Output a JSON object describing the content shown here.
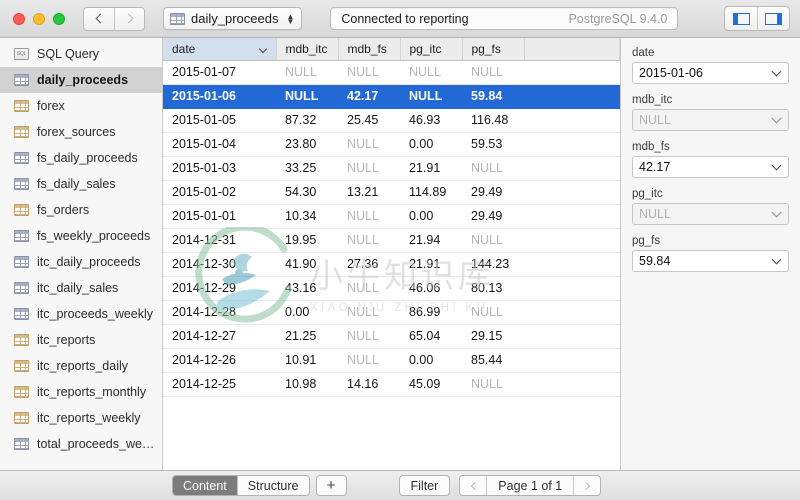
{
  "titlebar": {
    "back_label": "Back",
    "forward_label": "Forward",
    "table_picker_label": "daily_proceeds",
    "table_picker_icon": "table-icon",
    "status_text": "Connected to reporting",
    "server_version": "PostgreSQL 9.4.0",
    "left_panel_toggle": "left-panel-icon",
    "right_panel_toggle": "right-panel-icon"
  },
  "sidebar": {
    "items": [
      {
        "label": "SQL Query",
        "icon": "sql-query-icon",
        "selected": false
      },
      {
        "label": "daily_proceeds",
        "icon": "table-icon",
        "selected": true
      },
      {
        "label": "forex",
        "icon": "table-icon",
        "selected": false
      },
      {
        "label": "forex_sources",
        "icon": "table-icon",
        "selected": false
      },
      {
        "label": "fs_daily_proceeds",
        "icon": "table-icon",
        "selected": false
      },
      {
        "label": "fs_daily_sales",
        "icon": "table-icon",
        "selected": false
      },
      {
        "label": "fs_orders",
        "icon": "table-icon",
        "selected": false
      },
      {
        "label": "fs_weekly_proceeds",
        "icon": "table-icon",
        "selected": false
      },
      {
        "label": "itc_daily_proceeds",
        "icon": "table-icon",
        "selected": false
      },
      {
        "label": "itc_daily_sales",
        "icon": "table-icon",
        "selected": false
      },
      {
        "label": "itc_proceeds_weekly",
        "icon": "table-icon",
        "selected": false
      },
      {
        "label": "itc_reports",
        "icon": "table-icon",
        "selected": false
      },
      {
        "label": "itc_reports_daily",
        "icon": "table-icon",
        "selected": false
      },
      {
        "label": "itc_reports_monthly",
        "icon": "table-icon",
        "selected": false
      },
      {
        "label": "itc_reports_weekly",
        "icon": "table-icon",
        "selected": false
      },
      {
        "label": "total_proceeds_we…",
        "icon": "table-icon",
        "selected": false
      }
    ]
  },
  "grid": {
    "columns": [
      "date",
      "mdb_itc",
      "mdb_fs",
      "pg_itc",
      "pg_fs"
    ],
    "sorted_column": "date",
    "sort_direction": "descending",
    "null_text": "NULL",
    "selected_row_index": 1,
    "rows": [
      [
        "2015-01-07",
        "NULL",
        "NULL",
        "NULL",
        "NULL"
      ],
      [
        "2015-01-06",
        "NULL",
        "42.17",
        "NULL",
        "59.84"
      ],
      [
        "2015-01-05",
        "87.32",
        "25.45",
        "46.93",
        "116.48"
      ],
      [
        "2015-01-04",
        "23.80",
        "NULL",
        "0.00",
        "59.53"
      ],
      [
        "2015-01-03",
        "33.25",
        "NULL",
        "21.91",
        "NULL"
      ],
      [
        "2015-01-02",
        "54.30",
        "13.21",
        "114.89",
        "29.49"
      ],
      [
        "2015-01-01",
        "10.34",
        "NULL",
        "0.00",
        "29.49"
      ],
      [
        "2014-12-31",
        "19.95",
        "NULL",
        "21.94",
        "NULL"
      ],
      [
        "2014-12-30",
        "41.90",
        "27.36",
        "21.91",
        "144.23"
      ],
      [
        "2014-12-29",
        "43.16",
        "NULL",
        "46.06",
        "80.13"
      ],
      [
        "2014-12-28",
        "0.00",
        "NULL",
        "86.99",
        "NULL"
      ],
      [
        "2014-12-27",
        "21.25",
        "NULL",
        "65.04",
        "29.15"
      ],
      [
        "2014-12-26",
        "10.91",
        "NULL",
        "0.00",
        "85.44"
      ],
      [
        "2014-12-25",
        "10.98",
        "14.16",
        "45.09",
        "NULL"
      ]
    ]
  },
  "inspector": {
    "fields": [
      {
        "label": "date",
        "value": "2015-01-06",
        "is_null": false
      },
      {
        "label": "mdb_itc",
        "value": "NULL",
        "is_null": true
      },
      {
        "label": "mdb_fs",
        "value": "42.17",
        "is_null": false
      },
      {
        "label": "pg_itc",
        "value": "NULL",
        "is_null": true
      },
      {
        "label": "pg_fs",
        "value": "59.84",
        "is_null": false
      }
    ]
  },
  "bottombar": {
    "tab_content": "Content",
    "tab_structure": "Structure",
    "active_tab": "Content",
    "add_label": "+",
    "filter_label": "Filter",
    "page_label": "Page 1 of 1",
    "prev_label": "Previous page",
    "next_label": "Next page"
  },
  "watermark": {
    "cn": "小牛知识库",
    "en": "XIAO NIU ZHI SHI KU"
  },
  "colors": {
    "selection_blue": "#2269d6",
    "sorted_header": "#d4dfee",
    "null_gray": "#b6b6b6",
    "accent_blue": "#1f6fe0"
  }
}
